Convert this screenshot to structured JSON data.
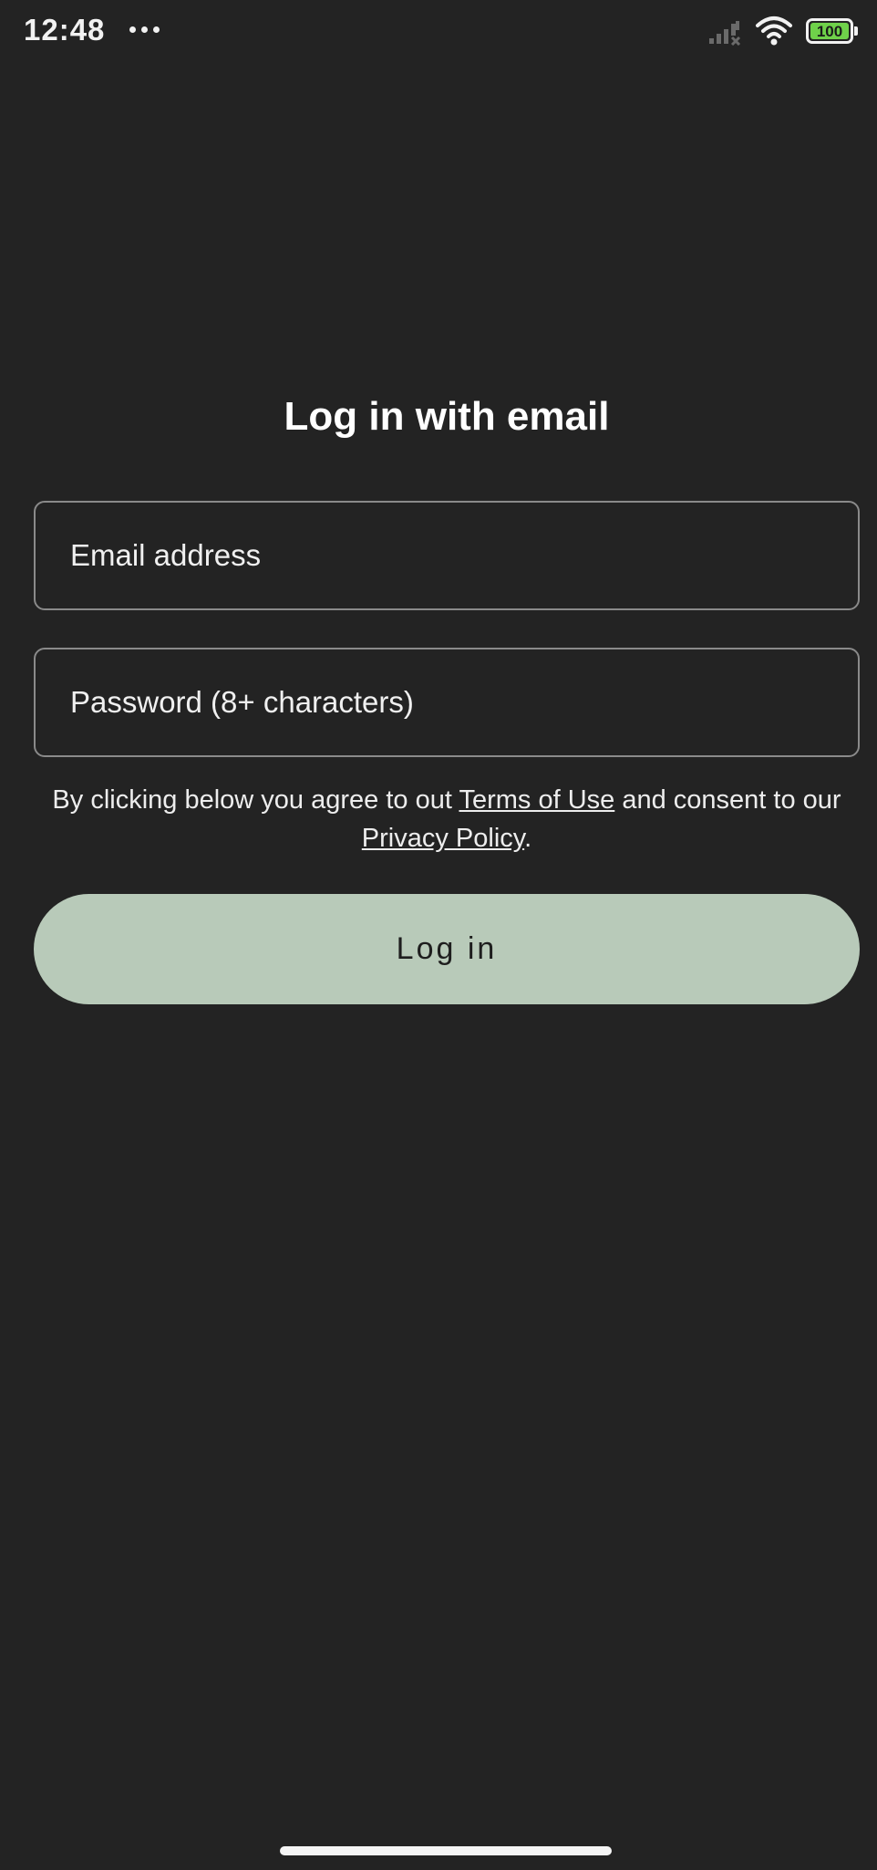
{
  "status_bar": {
    "time": "12:48",
    "battery_level": "100",
    "icons": [
      "more-dots-icon",
      "signal-icon",
      "wifi-icon",
      "battery-icon"
    ],
    "battery_color": "#6fd14a"
  },
  "login": {
    "title": "Log in with email",
    "email_placeholder": "Email address",
    "password_placeholder": "Password (8+ characters)",
    "consent_prefix": "By clicking below you agree to out",
    "terms_link": "Terms of Use",
    "consent_middle": "and consent to our",
    "privacy_link": "Privacy Policy",
    "consent_suffix": ".",
    "button_label": "Log in"
  },
  "colors": {
    "background": "#232323",
    "button": "#b8cab9",
    "field_border": "#8a8a8a"
  }
}
